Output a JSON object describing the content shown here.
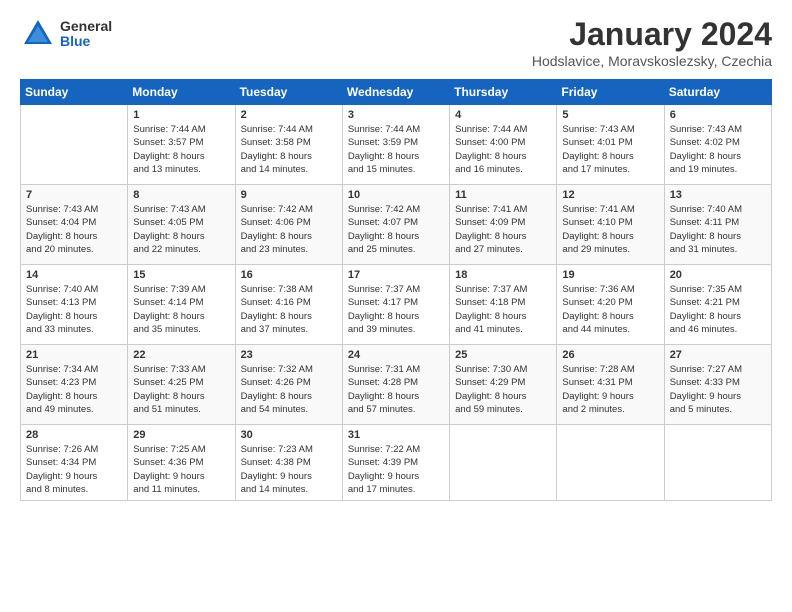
{
  "logo": {
    "general": "General",
    "blue": "Blue"
  },
  "title": {
    "month_year": "January 2024",
    "location": "Hodslavice, Moravskoslezsky, Czechia"
  },
  "days_of_week": [
    "Sunday",
    "Monday",
    "Tuesday",
    "Wednesday",
    "Thursday",
    "Friday",
    "Saturday"
  ],
  "weeks": [
    [
      {
        "day": "",
        "info": ""
      },
      {
        "day": "1",
        "info": "Sunrise: 7:44 AM\nSunset: 3:57 PM\nDaylight: 8 hours\nand 13 minutes."
      },
      {
        "day": "2",
        "info": "Sunrise: 7:44 AM\nSunset: 3:58 PM\nDaylight: 8 hours\nand 14 minutes."
      },
      {
        "day": "3",
        "info": "Sunrise: 7:44 AM\nSunset: 3:59 PM\nDaylight: 8 hours\nand 15 minutes."
      },
      {
        "day": "4",
        "info": "Sunrise: 7:44 AM\nSunset: 4:00 PM\nDaylight: 8 hours\nand 16 minutes."
      },
      {
        "day": "5",
        "info": "Sunrise: 7:43 AM\nSunset: 4:01 PM\nDaylight: 8 hours\nand 17 minutes."
      },
      {
        "day": "6",
        "info": "Sunrise: 7:43 AM\nSunset: 4:02 PM\nDaylight: 8 hours\nand 19 minutes."
      }
    ],
    [
      {
        "day": "7",
        "info": "Sunrise: 7:43 AM\nSunset: 4:04 PM\nDaylight: 8 hours\nand 20 minutes."
      },
      {
        "day": "8",
        "info": "Sunrise: 7:43 AM\nSunset: 4:05 PM\nDaylight: 8 hours\nand 22 minutes."
      },
      {
        "day": "9",
        "info": "Sunrise: 7:42 AM\nSunset: 4:06 PM\nDaylight: 8 hours\nand 23 minutes."
      },
      {
        "day": "10",
        "info": "Sunrise: 7:42 AM\nSunset: 4:07 PM\nDaylight: 8 hours\nand 25 minutes."
      },
      {
        "day": "11",
        "info": "Sunrise: 7:41 AM\nSunset: 4:09 PM\nDaylight: 8 hours\nand 27 minutes."
      },
      {
        "day": "12",
        "info": "Sunrise: 7:41 AM\nSunset: 4:10 PM\nDaylight: 8 hours\nand 29 minutes."
      },
      {
        "day": "13",
        "info": "Sunrise: 7:40 AM\nSunset: 4:11 PM\nDaylight: 8 hours\nand 31 minutes."
      }
    ],
    [
      {
        "day": "14",
        "info": "Sunrise: 7:40 AM\nSunset: 4:13 PM\nDaylight: 8 hours\nand 33 minutes."
      },
      {
        "day": "15",
        "info": "Sunrise: 7:39 AM\nSunset: 4:14 PM\nDaylight: 8 hours\nand 35 minutes."
      },
      {
        "day": "16",
        "info": "Sunrise: 7:38 AM\nSunset: 4:16 PM\nDaylight: 8 hours\nand 37 minutes."
      },
      {
        "day": "17",
        "info": "Sunrise: 7:37 AM\nSunset: 4:17 PM\nDaylight: 8 hours\nand 39 minutes."
      },
      {
        "day": "18",
        "info": "Sunrise: 7:37 AM\nSunset: 4:18 PM\nDaylight: 8 hours\nand 41 minutes."
      },
      {
        "day": "19",
        "info": "Sunrise: 7:36 AM\nSunset: 4:20 PM\nDaylight: 8 hours\nand 44 minutes."
      },
      {
        "day": "20",
        "info": "Sunrise: 7:35 AM\nSunset: 4:21 PM\nDaylight: 8 hours\nand 46 minutes."
      }
    ],
    [
      {
        "day": "21",
        "info": "Sunrise: 7:34 AM\nSunset: 4:23 PM\nDaylight: 8 hours\nand 49 minutes."
      },
      {
        "day": "22",
        "info": "Sunrise: 7:33 AM\nSunset: 4:25 PM\nDaylight: 8 hours\nand 51 minutes."
      },
      {
        "day": "23",
        "info": "Sunrise: 7:32 AM\nSunset: 4:26 PM\nDaylight: 8 hours\nand 54 minutes."
      },
      {
        "day": "24",
        "info": "Sunrise: 7:31 AM\nSunset: 4:28 PM\nDaylight: 8 hours\nand 57 minutes."
      },
      {
        "day": "25",
        "info": "Sunrise: 7:30 AM\nSunset: 4:29 PM\nDaylight: 8 hours\nand 59 minutes."
      },
      {
        "day": "26",
        "info": "Sunrise: 7:28 AM\nSunset: 4:31 PM\nDaylight: 9 hours\nand 2 minutes."
      },
      {
        "day": "27",
        "info": "Sunrise: 7:27 AM\nSunset: 4:33 PM\nDaylight: 9 hours\nand 5 minutes."
      }
    ],
    [
      {
        "day": "28",
        "info": "Sunrise: 7:26 AM\nSunset: 4:34 PM\nDaylight: 9 hours\nand 8 minutes."
      },
      {
        "day": "29",
        "info": "Sunrise: 7:25 AM\nSunset: 4:36 PM\nDaylight: 9 hours\nand 11 minutes."
      },
      {
        "day": "30",
        "info": "Sunrise: 7:23 AM\nSunset: 4:38 PM\nDaylight: 9 hours\nand 14 minutes."
      },
      {
        "day": "31",
        "info": "Sunrise: 7:22 AM\nSunset: 4:39 PM\nDaylight: 9 hours\nand 17 minutes."
      },
      {
        "day": "",
        "info": ""
      },
      {
        "day": "",
        "info": ""
      },
      {
        "day": "",
        "info": ""
      }
    ]
  ]
}
